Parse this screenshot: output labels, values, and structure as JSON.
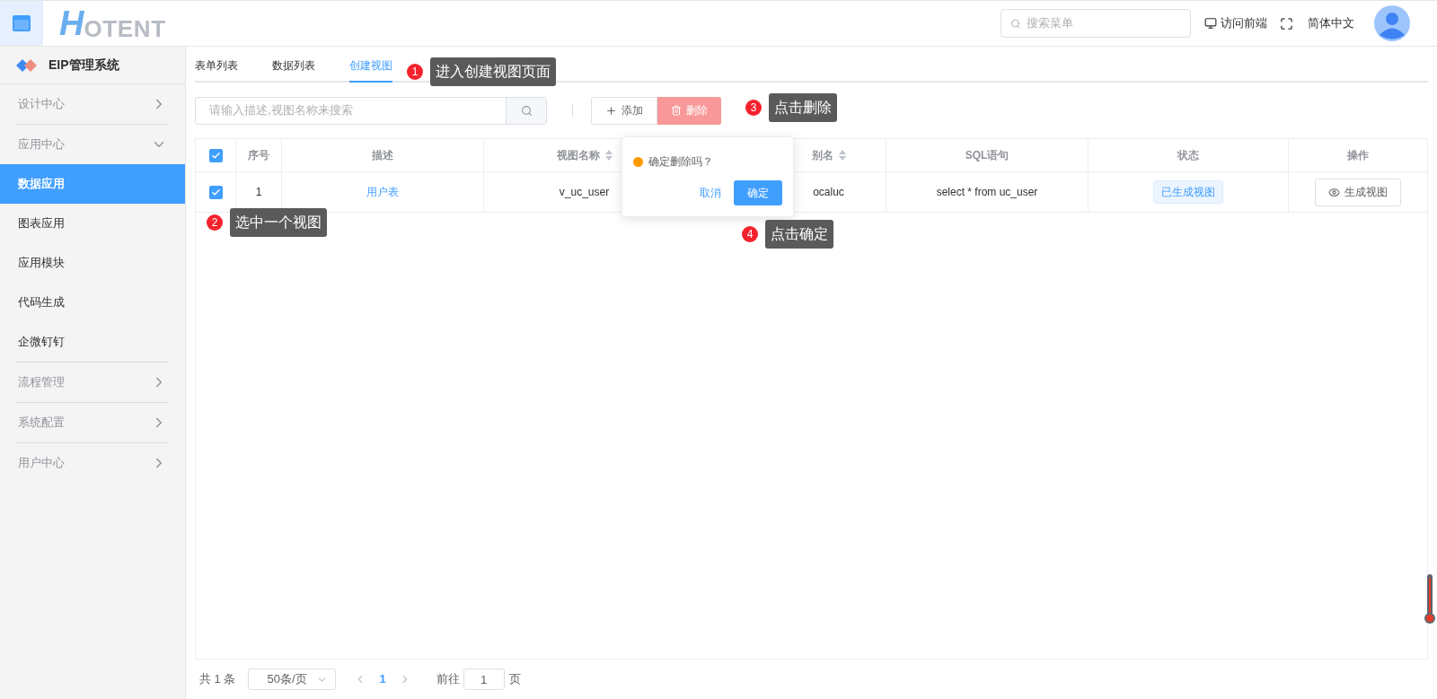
{
  "header": {
    "logo_letter": "H",
    "logo_rest": "OTENT",
    "search": {
      "placeholder": "搜索菜单"
    },
    "front_link": "访问前端",
    "language": "简体中文"
  },
  "sidebar": {
    "title": "EIP管理系统",
    "items": [
      {
        "label": "设计中心",
        "kind": "group",
        "expanded": false,
        "selected": false
      },
      {
        "label": "应用中心",
        "kind": "group",
        "expanded": true,
        "selected": false
      },
      {
        "label": "数据应用",
        "kind": "item",
        "selected": true
      },
      {
        "label": "图表应用",
        "kind": "item",
        "selected": false
      },
      {
        "label": "应用模块",
        "kind": "item",
        "selected": false
      },
      {
        "label": "代码生成",
        "kind": "item",
        "selected": false
      },
      {
        "label": "企微钉钉",
        "kind": "item",
        "selected": false
      },
      {
        "label": "流程管理",
        "kind": "group",
        "expanded": false,
        "selected": false
      },
      {
        "label": "系统配置",
        "kind": "group",
        "expanded": false,
        "selected": false
      },
      {
        "label": "用户中心",
        "kind": "group",
        "expanded": false,
        "selected": false
      }
    ]
  },
  "tabs": [
    {
      "label": "表单列表",
      "selected": false
    },
    {
      "label": "数据列表",
      "selected": false
    },
    {
      "label": "创建视图",
      "selected": true
    }
  ],
  "toolbar": {
    "search": {
      "placeholder": "请输入描述,视图名称来搜索"
    },
    "add_button": "添加",
    "delete_button": "删除"
  },
  "table": {
    "all_checked": true,
    "columns": [
      {
        "label": "序号",
        "kind": "plain"
      },
      {
        "label": "描述",
        "kind": "plain"
      },
      {
        "label": "视图名称",
        "kind": "sortable"
      },
      {
        "label": "别名",
        "kind": "sortable"
      },
      {
        "label": "SQL语句",
        "kind": "plain"
      },
      {
        "label": "状态",
        "kind": "plain"
      },
      {
        "label": "操作",
        "kind": "plain"
      }
    ],
    "rows": [
      {
        "checked": true,
        "index": "1",
        "description": "用户表",
        "view_name": "v_uc_user",
        "alias": "ocaluc",
        "sql": "select * from uc_user",
        "status": "已生成视图",
        "action": "生成视图"
      }
    ]
  },
  "popconfirm": {
    "message": "确定删除吗？",
    "cancel": "取消",
    "confirm": "确定"
  },
  "annotations": [
    {
      "number": "1",
      "text": "进入创建视图页面"
    },
    {
      "number": "2",
      "text": "选中一个视图"
    },
    {
      "number": "3",
      "text": "点击删除"
    },
    {
      "number": "4",
      "text": "点击确定"
    }
  ],
  "pagination": {
    "total": "共 1 条",
    "page_size": "50条/页",
    "pages": [
      {
        "label": "1",
        "selected": true
      }
    ],
    "goto_label": "前往",
    "goto_value": "1",
    "goto_suffix": "页"
  }
}
